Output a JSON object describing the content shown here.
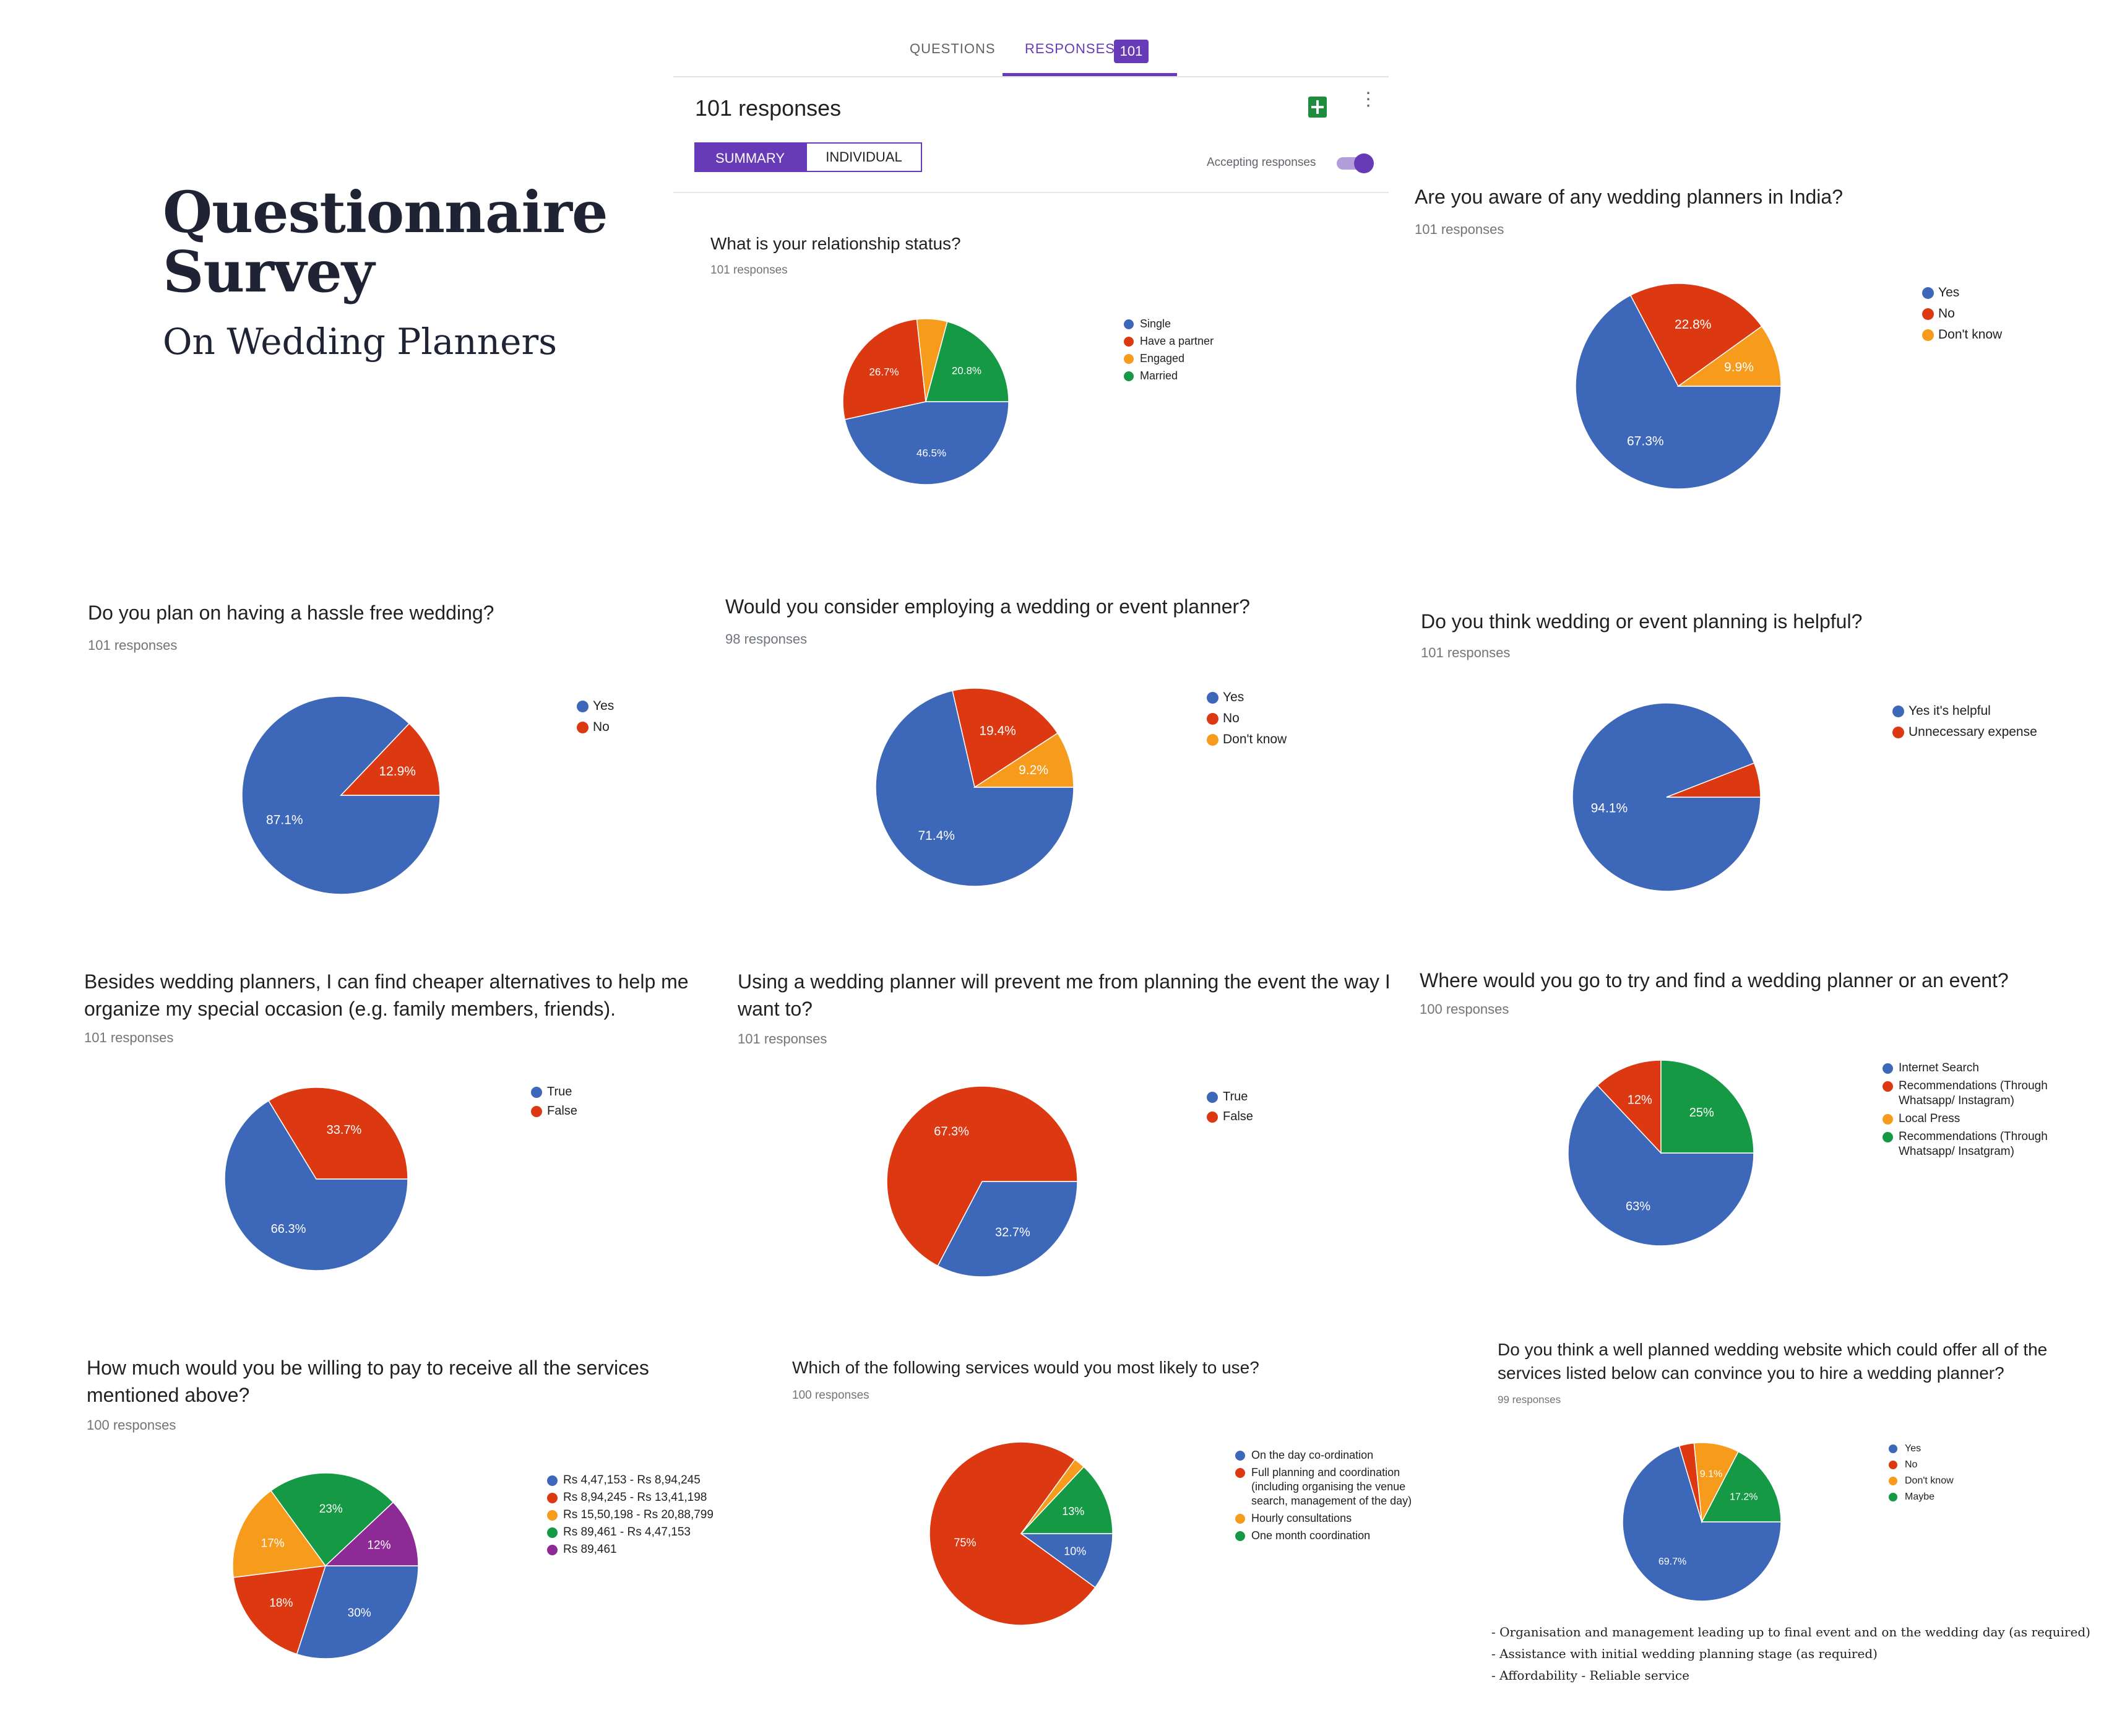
{
  "title": {
    "line1": "Questionnaire",
    "line2": "Survey",
    "subtitle": "On Wedding Planners"
  },
  "header": {
    "tab_questions": "QUESTIONS",
    "tab_responses": "RESPONSES",
    "responses_badge": "101",
    "response_count": "101 responses",
    "summary_button": "SUMMARY",
    "individual_button": "INDIVIDUAL",
    "accepting_label": "Accepting responses",
    "accepting_on": true
  },
  "colors": {
    "blue": "#3d67b8",
    "red": "#dc3912",
    "orange": "#f69b1b",
    "green": "#159945",
    "purple": "#8e2a96",
    "accent": "#673ab7"
  },
  "chart_data": [
    {
      "id": "c1",
      "type": "pie",
      "title": "What is your relationship status?",
      "responses": "101 responses",
      "legend": [
        "Single",
        "Have a partner",
        "Engaged",
        "Married"
      ],
      "values": [
        46.5,
        26.7,
        5.9,
        20.8
      ],
      "labels": [
        "46.5%",
        "26.7%",
        "",
        "20.8%"
      ]
    },
    {
      "id": "c2",
      "type": "pie",
      "title": "Are you aware of any wedding planners in India?",
      "responses": "101 responses",
      "legend": [
        "Yes",
        "No",
        "Don't know"
      ],
      "values": [
        67.3,
        22.8,
        9.9
      ],
      "labels": [
        "67.3%",
        "22.8%",
        "9.9%"
      ]
    },
    {
      "id": "c3",
      "type": "pie",
      "title": "Do you plan on having a hassle free wedding?",
      "responses": "101 responses",
      "legend": [
        "Yes",
        "No"
      ],
      "values": [
        87.1,
        12.9
      ],
      "labels": [
        "87.1%",
        "12.9%"
      ]
    },
    {
      "id": "c4",
      "type": "pie",
      "title": "Would you consider employing a wedding or event planner?",
      "responses": "98 responses",
      "legend": [
        "Yes",
        "No",
        "Don't know"
      ],
      "values": [
        71.4,
        19.4,
        9.2
      ],
      "labels": [
        "71.4%",
        "19.4%",
        "9.2%"
      ]
    },
    {
      "id": "c5",
      "type": "pie",
      "title": "Do you think wedding or event planning is helpful?",
      "responses": "101 responses",
      "legend": [
        "Yes it's helpful",
        "Unnecessary expense"
      ],
      "values": [
        94.1,
        5.9
      ],
      "labels": [
        "94.1%",
        ""
      ]
    },
    {
      "id": "c6",
      "type": "pie",
      "title": "Besides wedding planners, I can find cheaper alternatives to help me organize my special occasion (e.g. family members, friends).",
      "responses": "101 responses",
      "legend": [
        "True",
        "False"
      ],
      "values": [
        66.3,
        33.7
      ],
      "labels": [
        "66.3%",
        "33.7%"
      ]
    },
    {
      "id": "c7",
      "type": "pie",
      "title": "Using a wedding planner will prevent me from planning the event the way I want to?",
      "responses": "101 responses",
      "legend": [
        "True",
        "False"
      ],
      "values": [
        32.7,
        67.3
      ],
      "labels": [
        "32.7%",
        "67.3%"
      ]
    },
    {
      "id": "c8",
      "type": "pie",
      "title": "Where would you go to try and find a wedding planner or an event?",
      "responses": "100 responses",
      "legend": [
        "Internet Search",
        "Recommendations (Through Whatsapp/ Instagram)",
        "Local Press",
        "Recommendations (Through Whatsapp/ Insatgram)"
      ],
      "values": [
        63,
        12,
        0,
        25
      ],
      "labels": [
        "63%",
        "12%",
        "",
        "25%"
      ]
    },
    {
      "id": "c9",
      "type": "pie",
      "title": "How much would you be willing to pay to receive all the services mentioned above?",
      "responses": "100 responses",
      "legend": [
        "Rs 4,47,153 - Rs 8,94,245",
        "Rs 8,94,245 - Rs 13,41,198",
        "Rs 15,50,198 - Rs 20,88,799",
        "Rs 89,461 - Rs 4,47,153",
        "Rs 89,461"
      ],
      "values": [
        30,
        18,
        17,
        23,
        12
      ],
      "labels": [
        "30%",
        "18%",
        "17%",
        "23%",
        "12%"
      ]
    },
    {
      "id": "c10",
      "type": "pie",
      "title": "Which of the following services would you most likely to use?",
      "responses": "100 responses",
      "legend": [
        "On the day co-ordination",
        "Full planning and coordination (including organising the venue search, management of the day)",
        "Hourly consultations",
        "One month coordination"
      ],
      "values": [
        10,
        75,
        2,
        13
      ],
      "labels": [
        "10%",
        "75%",
        "",
        "13%"
      ]
    },
    {
      "id": "c11",
      "type": "pie",
      "title": "Do you think a well planned wedding website which could offer all of the services listed below can convince you to hire a wedding planner?",
      "responses": "99 responses",
      "legend": [
        "Yes",
        "No",
        "Don't know",
        "Maybe"
      ],
      "values": [
        69.7,
        3.0,
        9.1,
        17.2
      ],
      "labels": [
        "69.7%",
        "",
        "9.1%",
        "17.2%"
      ]
    }
  ],
  "notes": [
    "- Organisation and management leading up to final event and on the wedding day (as required)",
    "- Assistance with initial wedding planning stage (as required)",
    "- Affordability - Reliable service"
  ]
}
